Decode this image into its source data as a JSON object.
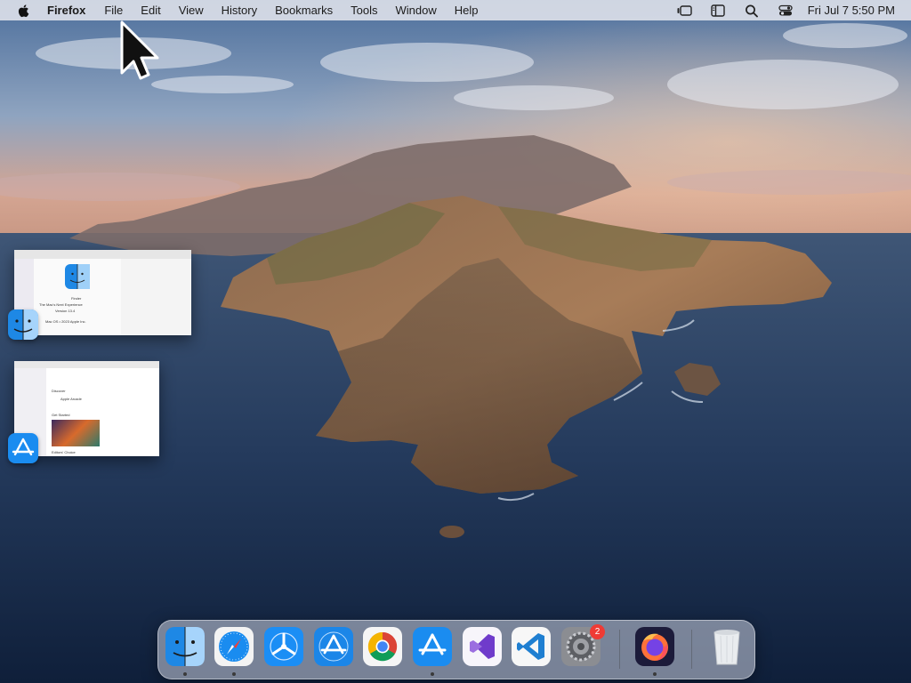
{
  "menubar": {
    "app_name": "Firefox",
    "items": [
      "File",
      "Edit",
      "View",
      "History",
      "Bookmarks",
      "Tools",
      "Window",
      "Help"
    ],
    "clock": "Fri Jul 7  5:50 PM"
  },
  "stage_manager": {
    "finder_window": {
      "app": "Finder",
      "lines": [
        "Finder",
        "The Mac's Next Experience",
        "Version 13.4",
        "Mac OS • 2023 Apple Inc."
      ]
    },
    "appstore_window": {
      "app": "App Store",
      "lines": [
        "Discover",
        "Apple Arcade",
        "Get Started",
        "Editors' Choice"
      ]
    }
  },
  "dock": {
    "apps": [
      {
        "name": "Finder",
        "running": true
      },
      {
        "name": "Safari",
        "running": true
      },
      {
        "name": "TestFlight",
        "running": false
      },
      {
        "name": "Xcode Instruments",
        "running": false
      },
      {
        "name": "Google Chrome",
        "running": false
      },
      {
        "name": "App Store",
        "running": true
      },
      {
        "name": "Visual Studio",
        "running": false
      },
      {
        "name": "Visual Studio Code",
        "running": false
      },
      {
        "name": "System Settings",
        "running": false,
        "badge": "2"
      },
      {
        "name": "Firefox",
        "running": true
      },
      {
        "name": "Trash",
        "running": false
      }
    ]
  },
  "colors": {
    "accent": "#1e88e5",
    "badge": "#ef3b35",
    "menubar_bg": "#e1e4ec"
  }
}
